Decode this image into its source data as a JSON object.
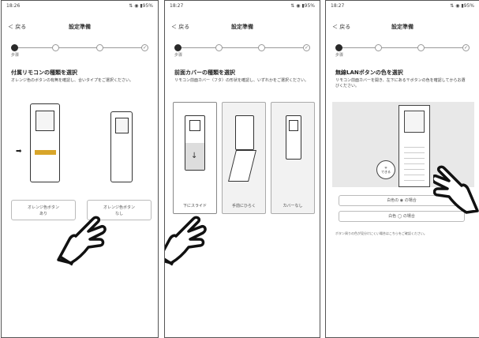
{
  "screens": [
    {
      "status_time": "18:26",
      "status_icons": "⇅ ◉ ▮95%",
      "back_label": "＜ 戻る",
      "title": "設定準備",
      "step_label": "步骤",
      "heading": "付属リモコンの種類を選択",
      "description": "オレンジ色のボタンの有無を確認し、合いタイプをご選択ください。",
      "options": [
        "オレンジ色ボタン\nあり",
        "オレンジ色ボタン\nなし"
      ]
    },
    {
      "status_time": "18:27",
      "status_icons": "⇅ ◉ ▮95%",
      "back_label": "＜ 戻る",
      "title": "設定準備",
      "step_label": "步骤",
      "heading": "前面カバーの種類を選択",
      "description": "リモコン前面カバー（フタ）の形状を確認し、いずれかをご選択ください。",
      "options": [
        "下にスライド",
        "手前にひらく",
        "カバーなし"
      ]
    },
    {
      "status_time": "18:27",
      "status_icons": "⇅ ◉ ▮95%",
      "back_label": "＜ 戻る",
      "title": "設定準備",
      "step_label": "步骤",
      "heading": "無線LANボタンの色を選択",
      "description": "リモコン前面カバーを開き、左下にある〒ボタンの色を確認してからお選びください。",
      "badge_label": "〒\nできる",
      "options": [
        "白色の ◉ の場合",
        "白色 ◯ の場合"
      ],
      "footnote": "ボタン周りの色が見分けにくい場合はこちらをご確認ください。"
    }
  ]
}
